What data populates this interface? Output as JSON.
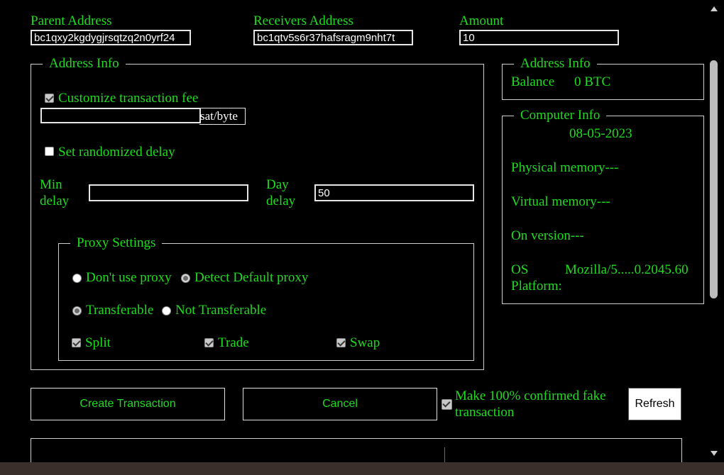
{
  "fields": {
    "parent_label": "Parent Address",
    "parent_value": "bc1qxy2kgdygjrsqtzq2n0yrf24",
    "receivers_label": "Receivers Address",
    "receivers_value": "bc1qtv5s6r37hafsragm9nht7t",
    "amount_label": "Amount",
    "amount_value": "10"
  },
  "left_panel": {
    "legend": "Address Info",
    "customize_fee": {
      "label": "Customize transaction fee",
      "checked": true
    },
    "fee_value": "",
    "fee_unit": "sat/byte",
    "randomized_delay": {
      "label": "Set randomized delay",
      "checked": false
    },
    "min_delay_line1": "Min",
    "min_delay_line2": "delay",
    "min_delay_value": "",
    "day_delay_line1": "Day",
    "day_delay_line2": "delay",
    "day_delay_value": "50"
  },
  "proxy": {
    "legend": "Proxy Settings",
    "dont_use": {
      "label": "Don't use proxy",
      "checked": false
    },
    "detect_default": {
      "label": "Detect Default proxy",
      "checked": true
    },
    "transferable": {
      "label": "Transferable",
      "checked": true
    },
    "not_transferable": {
      "label": "Not Transferable",
      "checked": false
    },
    "split": {
      "label": "Split",
      "checked": true
    },
    "trade": {
      "label": "Trade",
      "checked": true
    },
    "swap": {
      "label": "Swap",
      "checked": true
    }
  },
  "address_info": {
    "legend": "Address Info",
    "balance_label": "Balance",
    "balance_value": "0 BTC"
  },
  "computer_info": {
    "legend": "Computer Info",
    "date": "08-05-2023",
    "physical_memory": "Physical memory---",
    "virtual_memory": "Virtual memory---",
    "on_version": "On version---",
    "os_label_1": "OS",
    "os_label_2": "Platform:",
    "os_value": "Mozilla/5.....0.2045.60"
  },
  "actions": {
    "create": "Create Transaction",
    "cancel": "Cancel",
    "fake_line1": "Make 100% confirmed fake",
    "fake_line2": "transaction",
    "fake_checked": true,
    "refresh": "Refresh"
  },
  "colors": {
    "text_green": "#1fdc1f",
    "background": "#000000",
    "border": "#e6e6e6"
  }
}
